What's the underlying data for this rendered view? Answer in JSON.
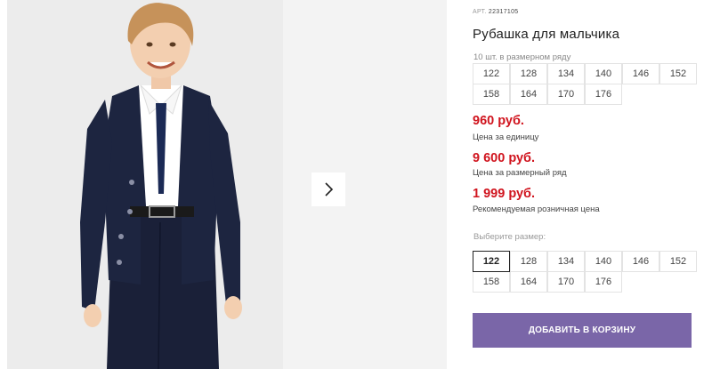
{
  "gallery": {
    "next_icon": "chevron-right-icon"
  },
  "product": {
    "art_label": "АРТ.",
    "art_value": "22317105",
    "title": "Рубашка для мальчика",
    "pack_note": "10 шт. в размерном ряду",
    "pack_sizes": [
      "122",
      "128",
      "134",
      "140",
      "146",
      "152",
      "158",
      "164",
      "170",
      "176"
    ],
    "prices": [
      {
        "value": "960 руб.",
        "label": "Цена за единицу"
      },
      {
        "value": "9 600 руб.",
        "label": "Цена за размерный ряд"
      },
      {
        "value": "1 999 руб.",
        "label": "Рекомендуемая розничная цена"
      }
    ],
    "choose_size_label": "Выберите размер:",
    "selectable_sizes": [
      "122",
      "128",
      "134",
      "140",
      "146",
      "152",
      "158",
      "164",
      "170",
      "176"
    ],
    "selected_size": "122",
    "add_to_cart": "ДОБАВИТЬ В КОРЗИНУ"
  },
  "colors": {
    "price": "#d0141e",
    "cart_button": "#7a66a8",
    "jacket": "#1d2540"
  }
}
